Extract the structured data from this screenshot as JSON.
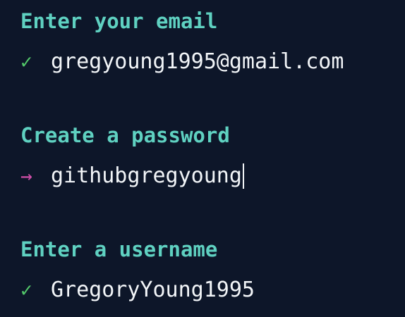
{
  "colors": {
    "background": "#0d1629",
    "label": "#5fd1c1",
    "check": "#53c86a",
    "arrow": "#d14fa9",
    "text": "#f2f5f8"
  },
  "prompts": [
    {
      "label": "Enter your email",
      "status_icon": "check-icon",
      "marker": "✓",
      "value": "gregyoung1995@gmail.com",
      "state": "completed"
    },
    {
      "label": "Create a password",
      "status_icon": "arrow-right-icon",
      "marker": "→",
      "value": "githubgregyoung",
      "state": "active"
    },
    {
      "label": "Enter a username",
      "status_icon": "check-icon",
      "marker": "✓",
      "value": "GregoryYoung1995",
      "state": "completed"
    }
  ]
}
